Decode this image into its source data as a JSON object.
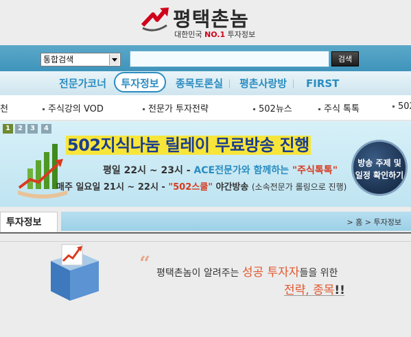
{
  "header": {
    "logo_name": "평택촌놈",
    "logo_sub_prefix": "대한민국 ",
    "logo_sub_no1": "NO.1",
    "logo_sub_suffix": " 투자정보"
  },
  "search": {
    "select_value": "통합검색",
    "input_value": "",
    "button_label": "검색"
  },
  "main_nav": {
    "items": [
      "전문가코너",
      "투자정보",
      "종목토론실",
      "평촌사랑방",
      "FIRST"
    ],
    "active": "투자정보"
  },
  "sub_nav": {
    "items": [
      "천",
      "주식강의 VOD",
      "전문가 투자전략",
      "502뉴스",
      "주식 톡톡",
      "502"
    ]
  },
  "banner": {
    "pages": [
      "1",
      "2",
      "3",
      "4"
    ],
    "active_page": "1",
    "title": "502지식나눔 릴레이 무료방송 진행",
    "line1_time": "평일 22시 ~ 23시 - ",
    "line1_who": "ACE전문가와 함께하는 ",
    "line1_quote": "\"주식톡톡\"",
    "line2_time": "매주 일요일 21시 ~ 22시 - ",
    "line2_quote": "\"502스쿨\"",
    "line2_rest": " 야간방송 ",
    "line2_note": "(소속전문가 롤링으로 진행)",
    "circle_line1": "방송 주제 및",
    "circle_line2": "일정 확인하기"
  },
  "section": {
    "tab_label": "투자정보",
    "breadcrumb": "> 홈 > 투자정보"
  },
  "intro": {
    "quote_mark": "“",
    "line1_a": "평택촌놈이 알려주는 ",
    "line1_em1": "성공 투자자",
    "line1_b": "들을 위한",
    "line2_text": "전략, 종목",
    "line2_ex": "!!"
  },
  "colors": {
    "brand_blue": "#2a8cc0",
    "brand_red": "#d0021b",
    "accent_orange": "#e2572e"
  }
}
